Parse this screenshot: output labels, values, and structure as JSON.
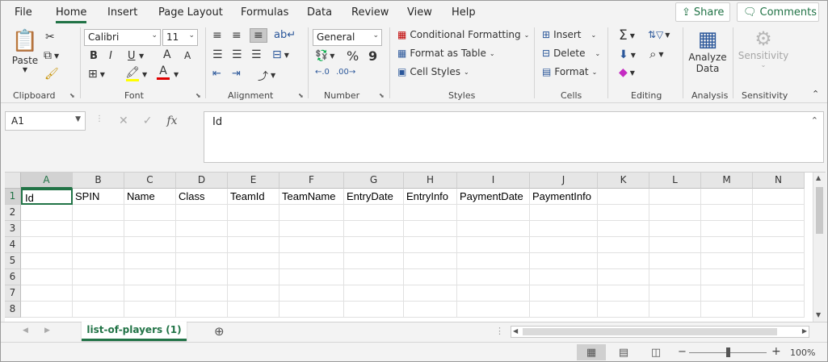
{
  "menu": [
    "File",
    "Home",
    "Insert",
    "Page Layout",
    "Formulas",
    "Data",
    "Review",
    "View",
    "Help"
  ],
  "share_label": "Share",
  "comments_label": "Comments",
  "ribbon": {
    "clipboard": {
      "paste": "Paste",
      "label": "Clipboard"
    },
    "font": {
      "name": "Calibri",
      "size": "11",
      "bold": "B",
      "italic": "I",
      "underline": "U",
      "grow": "A",
      "shrink": "A",
      "label": "Font"
    },
    "alignment": {
      "label": "Alignment"
    },
    "number": {
      "format": "General",
      "percent": "%",
      "comma": "9",
      "label": "Number"
    },
    "styles": {
      "conditional": "Conditional Formatting",
      "table": "Format as Table",
      "cell_styles": "Cell Styles",
      "label": "Styles"
    },
    "cells": {
      "insert": "Insert",
      "delete": "Delete",
      "format": "Format",
      "label": "Cells"
    },
    "editing": {
      "label": "Editing"
    },
    "analysis": {
      "analyze": "Analyze",
      "data": "Data",
      "label": "Analysis"
    },
    "sensitivity": {
      "button": "Sensitivity",
      "label": "Sensitivity"
    }
  },
  "formula_bar": {
    "name_box": "A1",
    "fx": "fx",
    "value": "Id"
  },
  "grid": {
    "columns": [
      "A",
      "B",
      "C",
      "D",
      "E",
      "F",
      "G",
      "H",
      "I",
      "J",
      "K",
      "L",
      "M",
      "N"
    ],
    "rows": [
      "1",
      "2",
      "3",
      "4",
      "5",
      "6",
      "7",
      "8"
    ],
    "row1": [
      "Id",
      "SPIN",
      "Name",
      "Class",
      "TeamId",
      "TeamName",
      "EntryDate",
      "EntryInfo",
      "PaymentDate",
      "PaymentInfo",
      "",
      "",
      "",
      ""
    ]
  },
  "sheet_tab": "list-of-players (1)",
  "status": {
    "zoom": "100%",
    "minus": "−",
    "plus": "+"
  },
  "colors": {
    "accent": "#217346",
    "font_color_bar": "#e00000",
    "highlight_bar": "#ffff00"
  }
}
